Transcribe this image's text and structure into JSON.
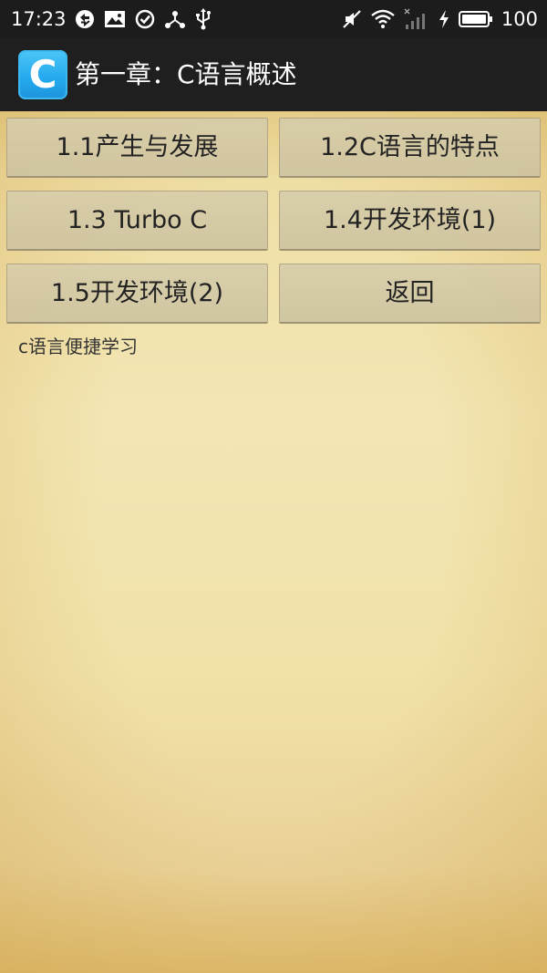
{
  "status_bar": {
    "time": "17:23",
    "battery_text": "100",
    "left_icons": [
      "sync-icon",
      "image-icon",
      "check-circle-icon",
      "share-icon",
      "usb-icon"
    ],
    "right_icons": [
      "mute-icon",
      "wifi-icon",
      "signal-icon",
      "charging-icon",
      "battery-icon"
    ]
  },
  "action_bar": {
    "app_icon_letter": "C",
    "title": "第一章：C语言概述",
    "app_icon_color": "#23a8ee"
  },
  "buttons": [
    {
      "label": "1.1产生与发展"
    },
    {
      "label": "1.2C语言的特点"
    },
    {
      "label": "1.3 Turbo C"
    },
    {
      "label": "1.4开发环境(1)"
    },
    {
      "label": "1.5开发环境(2)"
    },
    {
      "label": "返回"
    }
  ],
  "footer": {
    "text": "c语言便捷学习"
  }
}
